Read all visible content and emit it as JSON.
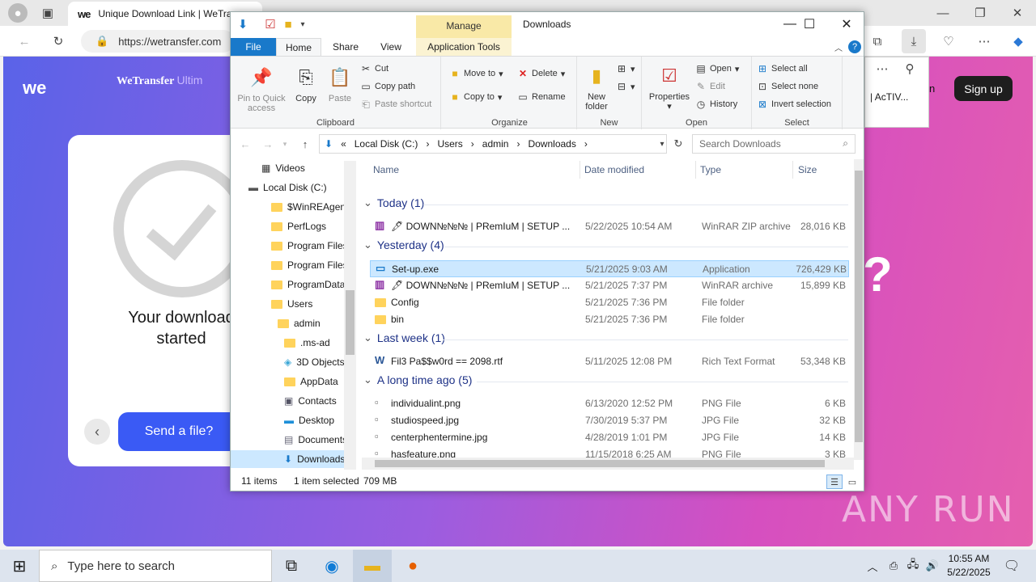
{
  "browser": {
    "tab_title": "Unique Download Link | WeTra",
    "url": "https://wetransfer.com",
    "page": {
      "brand": "we",
      "brand_name": "WeTransfer",
      "brand_suffix": "Ultim",
      "download_text_line1": "Your download",
      "download_text_line2": "started",
      "send_button": "Send a file?",
      "signup": "Sign up",
      "menu_snippet": "| AcTIV...",
      "menu_snippet2": "n",
      "qmark": "?"
    }
  },
  "explorer": {
    "title": "Downloads",
    "contextual_tab": "Manage",
    "tabs": [
      "File",
      "Home",
      "Share",
      "View",
      "Application Tools"
    ],
    "ribbon": {
      "clipboard": {
        "label": "Clipboard",
        "pin": "Pin to Quick access",
        "copy": "Copy",
        "paste": "Paste",
        "cut": "Cut",
        "copy_path": "Copy path",
        "paste_shortcut": "Paste shortcut"
      },
      "organize": {
        "label": "Organize",
        "move_to": "Move to",
        "copy_to": "Copy to",
        "delete": "Delete",
        "rename": "Rename"
      },
      "new": {
        "label": "New",
        "new_folder": "New folder"
      },
      "open": {
        "label": "Open",
        "properties": "Properties",
        "open": "Open",
        "edit": "Edit",
        "history": "History"
      },
      "select": {
        "label": "Select",
        "select_all": "Select all",
        "select_none": "Select none",
        "invert": "Invert selection"
      }
    },
    "breadcrumb": [
      "Local Disk (C:)",
      "Users",
      "admin",
      "Downloads"
    ],
    "search_placeholder": "Search Downloads",
    "nav_items": [
      "Videos",
      "Local Disk (C:)",
      "$WinREAgent",
      "PerfLogs",
      "Program Files",
      "Program Files",
      "ProgramData",
      "Users",
      "admin",
      ".ms-ad",
      "3D Objects",
      "AppData",
      "Contacts",
      "Desktop",
      "Documents",
      "Downloads"
    ],
    "columns": [
      "Name",
      "Date modified",
      "Type",
      "Size"
    ],
    "groups": [
      {
        "label": "Today (1)",
        "files": [
          {
            "name": "🖋 DOWN№№№ | PRemIuM | SETUP ...",
            "date": "5/22/2025 10:54 AM",
            "type": "WinRAR ZIP archive",
            "size": "28,016 KB",
            "icon": "rar-icon"
          }
        ]
      },
      {
        "label": "Yesterday (4)",
        "files": [
          {
            "name": "Set-up.exe",
            "date": "5/21/2025 9:03 AM",
            "type": "Application",
            "size": "726,429 KB",
            "icon": "exe-icon",
            "selected": true
          },
          {
            "name": "🖋 DOWN№№№ | PRemIuM | SETUP ...",
            "date": "5/21/2025 7:37 PM",
            "type": "WinRAR archive",
            "size": "15,899 KB",
            "icon": "rar-icon"
          },
          {
            "name": "Config",
            "date": "5/21/2025 7:36 PM",
            "type": "File folder",
            "size": "",
            "icon": "folder-icon"
          },
          {
            "name": "bin",
            "date": "5/21/2025 7:36 PM",
            "type": "File folder",
            "size": "",
            "icon": "folder-icon"
          }
        ]
      },
      {
        "label": "Last week (1)",
        "files": [
          {
            "name": "Fil3 Pa$$w0rd == 2098.rtf",
            "date": "5/11/2025 12:08 PM",
            "type": "Rich Text Format",
            "size": "53,348 KB",
            "icon": "rtf-icon"
          }
        ]
      },
      {
        "label": "A long time ago (5)",
        "files": [
          {
            "name": "individualint.png",
            "date": "6/13/2020 12:52 PM",
            "type": "PNG File",
            "size": "6 KB",
            "icon": "image-icon"
          },
          {
            "name": "studiospeed.jpg",
            "date": "7/30/2019 5:37 PM",
            "type": "JPG File",
            "size": "32 KB",
            "icon": "image-icon"
          },
          {
            "name": "centerphentermine.jpg",
            "date": "4/28/2019 1:01 PM",
            "type": "JPG File",
            "size": "14 KB",
            "icon": "image-icon"
          },
          {
            "name": "hasfeature.png",
            "date": "11/15/2018 6:25 AM",
            "type": "PNG File",
            "size": "3 KB",
            "icon": "image-icon"
          }
        ]
      }
    ],
    "status": {
      "items": "11 items",
      "selected": "1 item selected",
      "size": "709 MB"
    }
  },
  "taskbar": {
    "search_placeholder": "Type here to search",
    "time": "10:55 AM",
    "date": "5/22/2025"
  },
  "watermark": "ANY RUN",
  "colors": {
    "accent": "#1979ca",
    "selection": "#cce8ff",
    "group_header": "#1e3287",
    "send_button": "#3a5af5"
  }
}
